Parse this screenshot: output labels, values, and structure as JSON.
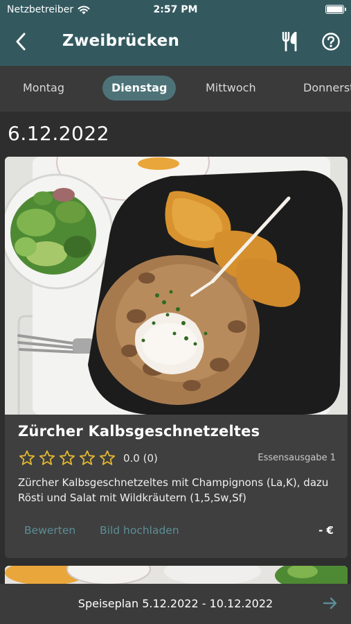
{
  "status_bar": {
    "carrier": "Netzbetreiber",
    "time": "2:57 PM"
  },
  "nav": {
    "title": "Zweibrücken"
  },
  "tabs": [
    {
      "label": "Montag"
    },
    {
      "label": "Dienstag",
      "active": true
    },
    {
      "label": "Mittwoch"
    },
    {
      "label": "Donnerstag"
    }
  ],
  "date": "6.12.2022",
  "meal": {
    "name": "Zürcher Kalbsgeschnetzeltes",
    "rating": "0.0 (0)",
    "stars_filled": 0,
    "stars_total": 5,
    "outlet": "Essensausgabe 1",
    "description": "Zürcher Kalbsgeschnetzeltes mit Champignons (La,K), dazu Rösti und Salat mit Wildkräutern (1,5,Sw,Sf)",
    "rate_label": "Bewerten",
    "upload_label": "Bild hochladen",
    "price": "- €"
  },
  "footer": {
    "label": "Speiseplan 5.12.2022 - 10.12.2022"
  },
  "colors": {
    "header": "#33595f",
    "active_tab": "#4d7378",
    "link": "#5b8e96",
    "star": "#e4b731"
  }
}
